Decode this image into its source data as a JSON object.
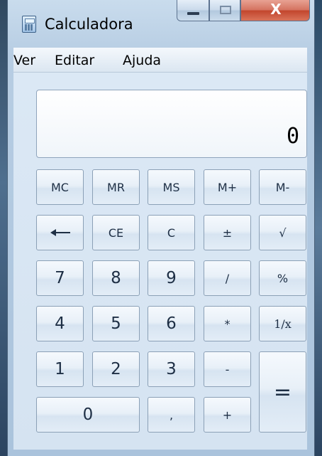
{
  "window": {
    "title": "Calculadora",
    "icon": "calculator-icon",
    "close_label": "X"
  },
  "menu": {
    "items": [
      "Ver",
      "Editar",
      "Ajuda"
    ]
  },
  "display": {
    "value": "0"
  },
  "keys": {
    "mc": "MC",
    "mr": "MR",
    "ms": "MS",
    "mplus": "M+",
    "mminus": "M-",
    "backspace_icon": "backspace-arrow-icon",
    "ce": "CE",
    "c": "C",
    "plusminus": "±",
    "sqrt": "√",
    "n7": "7",
    "n8": "8",
    "n9": "9",
    "divide": "/",
    "percent": "%",
    "n4": "4",
    "n5": "5",
    "n6": "6",
    "multiply": "*",
    "reciprocal": "1/x",
    "n1": "1",
    "n2": "2",
    "n3": "3",
    "minus": "-",
    "equals": "=",
    "n0": "0",
    "decimal": ",",
    "plus": "+"
  },
  "colors": {
    "close_button": "#c2452c",
    "window_frame": "#b7cde3",
    "key_face": "#e8f0f8"
  }
}
